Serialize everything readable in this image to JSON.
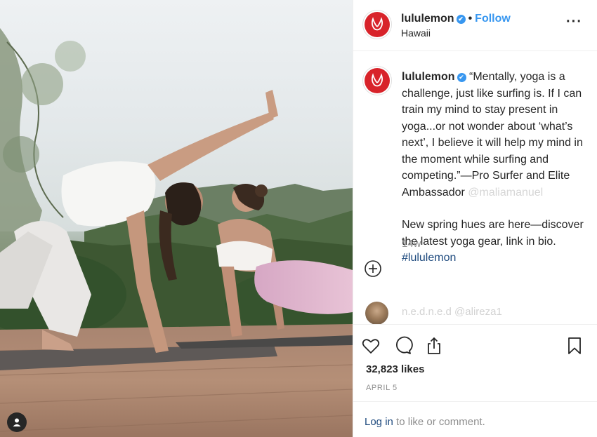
{
  "post": {
    "author": "lululemon",
    "verified_mark": "✔",
    "follow_label": "Follow",
    "separator": "•",
    "location": "Hawaii",
    "more_label": "···"
  },
  "caption": {
    "author": "lululemon",
    "verified_mark": "✔",
    "quote": "“Mentally, yoga is a challenge, just like surfing is. If I can train my mind to stay present in yoga...or not wonder about ‘what’s next’, I believe it will help my mind in the moment while surfing and competing.”—Pro Surfer and Elite Ambassador ",
    "mention": "@maliamanuel",
    "body": "New spring hues are here—discover the latest yoga gear, link in bio. ",
    "hashtag": "#lululemon",
    "time": "14w"
  },
  "comment_preview": {
    "text": "n.e.d.n.e.d @alireza1"
  },
  "actions": {
    "icons": [
      "heart-icon",
      "comment-icon",
      "share-icon",
      "bookmark-icon"
    ],
    "likes": "32,823 likes",
    "date": "APRIL 5"
  },
  "footer": {
    "login_link": "Log in",
    "login_rest": " to like or comment."
  },
  "colors": {
    "brand_red": "#d8232a",
    "link_blue": "#3897f0",
    "hashtag_blue": "#1e4a7e",
    "muted": "#8e8e8e"
  }
}
